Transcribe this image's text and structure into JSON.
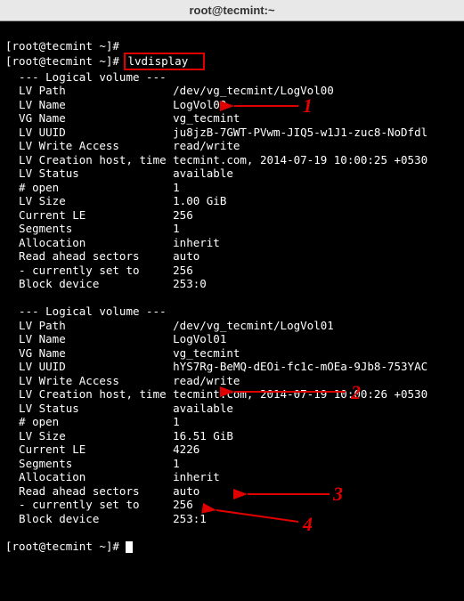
{
  "window": {
    "title": "root@tecmint:~"
  },
  "prompt": {
    "p1_user": "root@tecmint",
    "p1_path": " ~",
    "p1_suffix": "]#",
    "cmd_blank": "",
    "p2_user": "root@tecmint",
    "p2_path": " ~",
    "p2_suffix": "]# ",
    "cmd_lvdisplay": "lvdisplay",
    "p3_user": "root@tecmint",
    "p3_path": " ~",
    "p3_suffix": "]# "
  },
  "lv1": {
    "header": "  --- Logical volume ---",
    "path_l": "  LV Path               ",
    "path_v": " /dev/vg_tecmint/LogVol00",
    "name_l": "  LV Name               ",
    "name_v": " LogVol00",
    "vg_l": "  VG Name               ",
    "vg_v": " vg_tecmint",
    "uuid_l": "  LV UUID               ",
    "uuid_v": " ju8jzB-7GWT-PVwm-JIQ5-w1J1-zuc8-NoDfdl",
    "wa_l": "  LV Write Access       ",
    "wa_v": " read/write",
    "ch_l": "  LV Creation host, time",
    "ch_v": " tecmint.com, 2014-07-19 10:00:25 +0530",
    "st_l": "  LV Status             ",
    "st_v": " available",
    "op_l": "  # open                ",
    "op_v": " 1",
    "sz_l": "  LV Size               ",
    "sz_v": " 1.00 GiB",
    "le_l": "  Current LE            ",
    "le_v": " 256",
    "sg_l": "  Segments              ",
    "sg_v": " 1",
    "al_l": "  Allocation            ",
    "al_v": " inherit",
    "ra_l": "  Read ahead sectors    ",
    "ra_v": " auto",
    "cs_l": "  - currently set to    ",
    "cs_v": " 256",
    "bd_l": "  Block device          ",
    "bd_v": " 253:0"
  },
  "lv2": {
    "header": "  --- Logical volume ---",
    "path_l": "  LV Path               ",
    "path_v": " /dev/vg_tecmint/LogVol01",
    "name_l": "  LV Name               ",
    "name_v": " LogVol01",
    "vg_l": "  VG Name               ",
    "vg_v": " vg_tecmint",
    "uuid_l": "  LV UUID               ",
    "uuid_v": " hYS7Rg-BeMQ-dEOi-fc1c-mOEa-9Jb8-753YAC",
    "wa_l": "  LV Write Access       ",
    "wa_v": " read/write",
    "ch_l": "  LV Creation host, time",
    "ch_v": " tecmint.com, 2014-07-19 10:00:26 +0530",
    "st_l": "  LV Status             ",
    "st_v": " available",
    "op_l": "  # open                ",
    "op_v": " 1",
    "sz_l": "  LV Size               ",
    "sz_v": " 16.51 GiB",
    "le_l": "  Current LE            ",
    "le_v": " 4226",
    "sg_l": "  Segments              ",
    "sg_v": " 1",
    "al_l": "  Allocation            ",
    "al_v": " inherit",
    "ra_l": "  Read ahead sectors    ",
    "ra_v": " auto",
    "cs_l": "  - currently set to    ",
    "cs_v": " 256",
    "bd_l": "  Block device          ",
    "bd_v": " 253:1"
  },
  "annotations": {
    "n1": "1",
    "n2": "2",
    "n3": "3",
    "n4": "4"
  }
}
